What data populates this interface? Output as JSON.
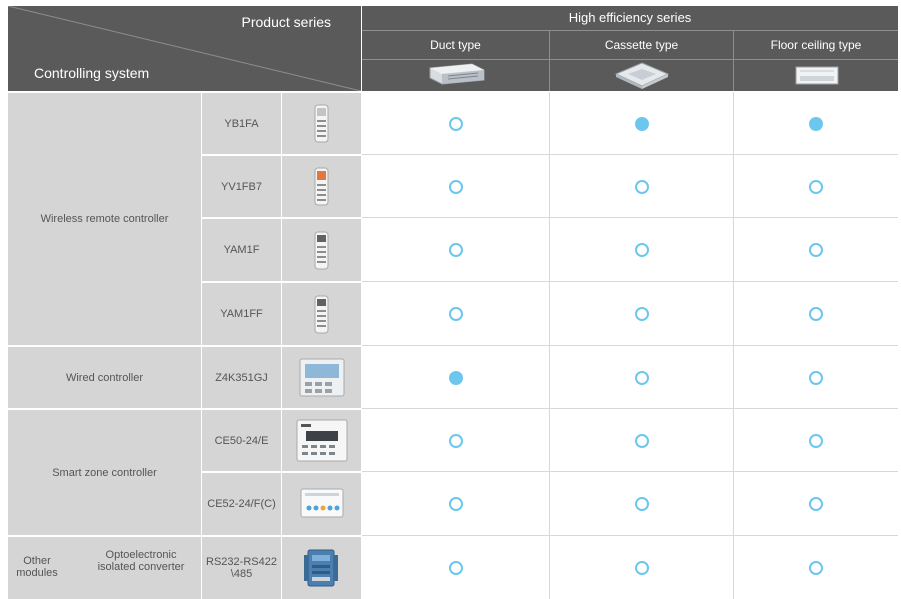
{
  "header": {
    "product_series": "Product series",
    "controlling_system": "Controlling system",
    "series_name": "High efficiency series",
    "types": [
      {
        "label": "Duct type",
        "icon": "duct-unit-icon"
      },
      {
        "label": "Cassette type",
        "icon": "cassette-unit-icon"
      },
      {
        "label": "Floor ceiling type",
        "icon": "floor-ceiling-unit-icon"
      }
    ]
  },
  "groups": {
    "wireless": "Wireless remote controller",
    "wired": "Wired controller",
    "smart": "Smart zone controller",
    "other_left": "Other modules",
    "other_right": "Optoelectronic isolated converter"
  },
  "rows": [
    {
      "model": "YB1FA",
      "icon": "remote-controller-icon",
      "marks": [
        "open",
        "filled",
        "filled"
      ]
    },
    {
      "model": "YV1FB7",
      "icon": "remote-controller-icon",
      "marks": [
        "open",
        "open",
        "open"
      ]
    },
    {
      "model": "YAM1F",
      "icon": "remote-controller-icon",
      "marks": [
        "open",
        "open",
        "open"
      ]
    },
    {
      "model": "YAM1FF",
      "icon": "remote-controller-icon",
      "marks": [
        "open",
        "open",
        "open"
      ]
    },
    {
      "model": "Z4K351GJ",
      "icon": "wired-panel-icon",
      "marks": [
        "filled",
        "open",
        "open"
      ]
    },
    {
      "model": "CE50-24/E",
      "icon": "zone-controller-icon",
      "marks": [
        "open",
        "open",
        "open"
      ]
    },
    {
      "model": "CE52-24/F(C)",
      "icon": "touch-controller-icon",
      "marks": [
        "open",
        "open",
        "open"
      ]
    },
    {
      "model": "RS232-RS422 \\485",
      "icon": "converter-module-icon",
      "marks": [
        "open",
        "open",
        "open"
      ]
    }
  ],
  "colors": {
    "header_bg": "#5a5a5a",
    "cell_bg": "#d5d5d5",
    "mark": "#6cc6ee"
  }
}
